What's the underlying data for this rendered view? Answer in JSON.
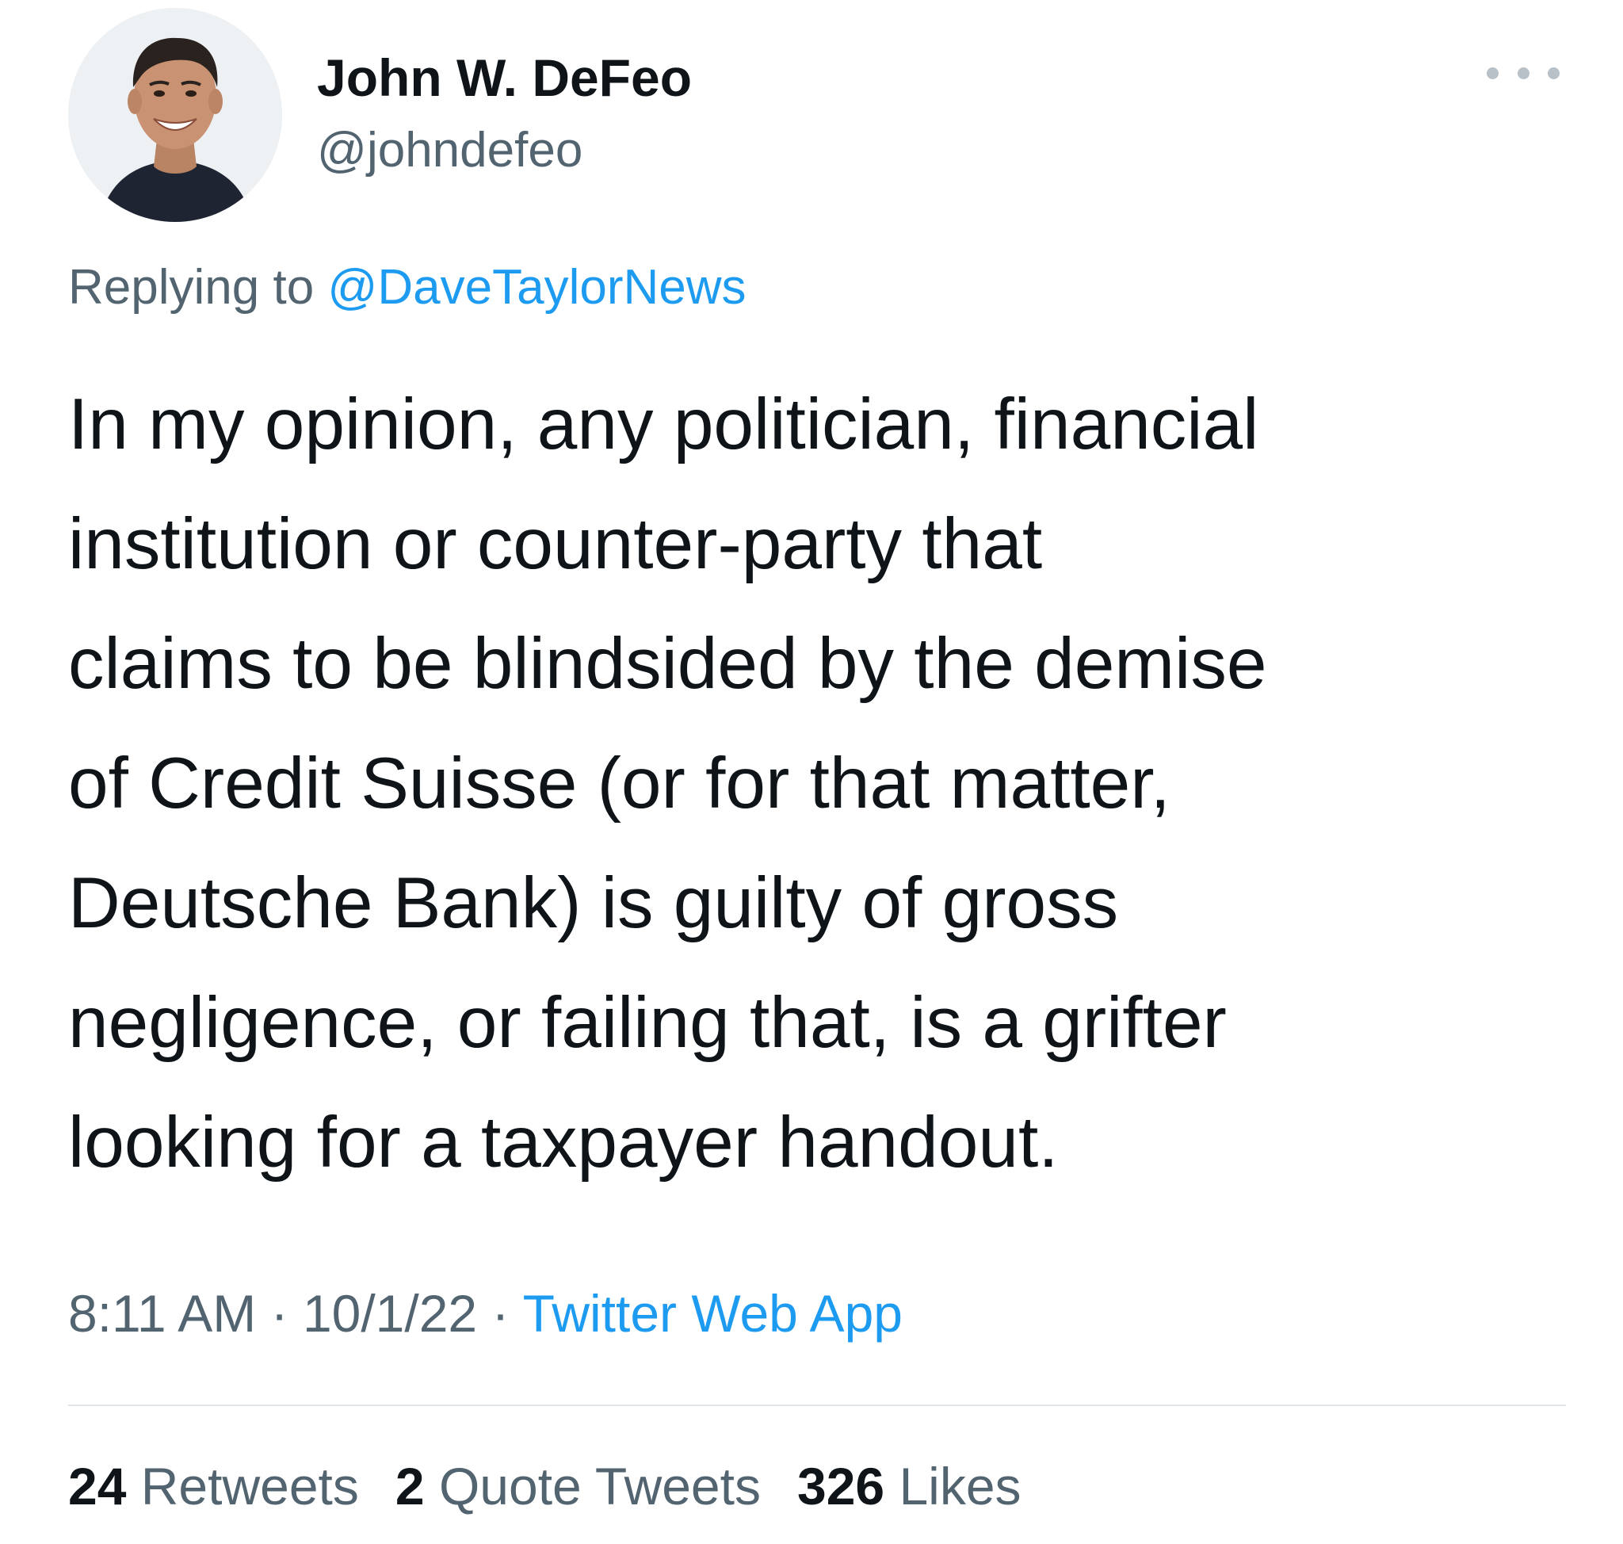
{
  "author": {
    "display_name": "John W. DeFeo",
    "handle": "@johndefeo"
  },
  "more_icon": "more-horizontal-icon",
  "reply": {
    "prefix": "Replying to",
    "mention": "@DaveTaylorNews"
  },
  "body_lines": [
    "In my opinion, any politician, financial",
    "institution or counter-party that",
    "claims to be blindsided by the demise",
    "of Credit Suisse (or for that matter,",
    "Deutsche Bank) is guilty of gross",
    "negligence, or failing that, is a grifter",
    "looking for a taxpayer handout."
  ],
  "meta": {
    "time": "8:11 AM",
    "separator": "·",
    "date": "10/1/22",
    "source": "Twitter Web App"
  },
  "stats": {
    "retweets_count": "24",
    "retweets_label": "Retweets",
    "quotes_count": "2",
    "quotes_label": "Quote Tweets",
    "likes_count": "326",
    "likes_label": "Likes"
  },
  "colors": {
    "accent": "#1d9bf0",
    "secondary_text": "#536471",
    "primary_text": "#0f1419",
    "divider": "#e1e6ea"
  }
}
